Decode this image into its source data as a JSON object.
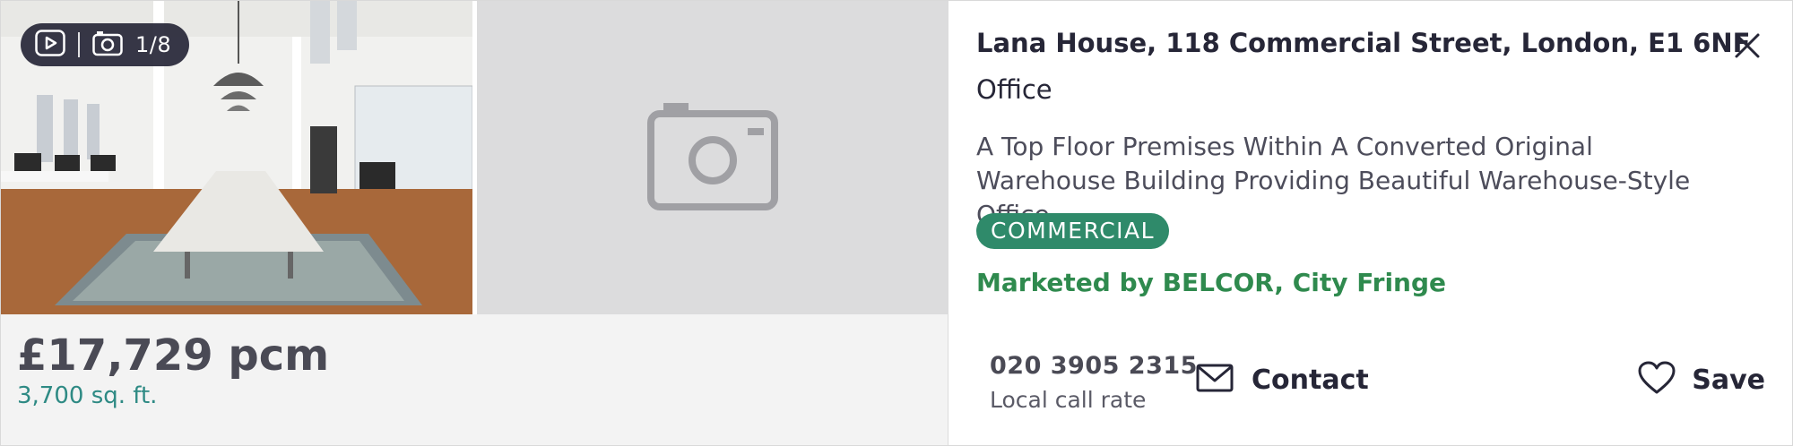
{
  "media": {
    "photo_counter": "1/8",
    "video_icon": "play-icon",
    "camera_icon": "camera-icon",
    "placeholder_icon": "camera-placeholder-icon"
  },
  "listing": {
    "price": "£17,729 pcm",
    "size": "3,700 sq. ft.",
    "address": "Lana House, 118 Commercial Street, London, E1 6NF",
    "property_type": "Office",
    "summary": "A Top Floor Premises Within A Converted Original Warehouse Building Providing Beautiful Warehouse-Style Office",
    "tag": "COMMERCIAL",
    "marketed_by": "Marketed by BELCOR, City Fringe"
  },
  "actions": {
    "phone": "020 3905 2315",
    "call_rate": "Local call rate",
    "contact_label": "Contact",
    "save_label": "Save"
  },
  "colors": {
    "accent_green": "#2f8a6a",
    "marketed_green": "#2f8a4e",
    "size_teal": "#2e8a84",
    "text_dark": "#262637"
  }
}
